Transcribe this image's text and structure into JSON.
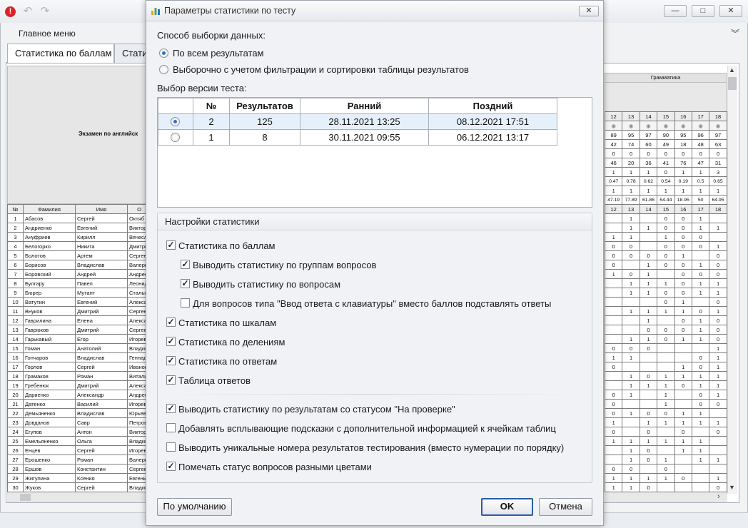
{
  "main_window": {
    "menu": "Главное меню",
    "tabs": [
      "Статистика по баллам",
      "Стати"
    ],
    "exam_title": "Экзамен по английск",
    "grammar_header": "Грамматика",
    "left_headers": [
      "№",
      "Фамилия",
      "Имя",
      "О"
    ],
    "students": [
      [
        "1",
        "Абасов",
        "Сергей",
        "Октяб"
      ],
      [
        "2",
        "Андриенко",
        "Евгений",
        "Виктор"
      ],
      [
        "3",
        "Ануфриев",
        "Кирилл",
        "Вячесл"
      ],
      [
        "4",
        "Белогорко",
        "Никита",
        "Дмитри"
      ],
      [
        "5",
        "Болотов",
        "Артем",
        "Сергее"
      ],
      [
        "6",
        "Борисов",
        "Владислав",
        "Валери"
      ],
      [
        "7",
        "Боровский",
        "Андрей",
        "Андрее"
      ],
      [
        "8",
        "Булгару",
        "Павел",
        "Леонид"
      ],
      [
        "9",
        "Бюрер",
        "Мутант",
        "Стальн"
      ],
      [
        "10",
        "Ватутин",
        "Евгений",
        "Алекса"
      ],
      [
        "11",
        "Внуков",
        "Дмитрий",
        "Сергее"
      ],
      [
        "12",
        "Гаврилина",
        "Елена",
        "Алекса"
      ],
      [
        "13",
        "Гаврюков",
        "Дмитрий",
        "Сергее"
      ],
      [
        "14",
        "Гарькавый",
        "Егор",
        "Игорев"
      ],
      [
        "15",
        "Гоман",
        "Анатолий",
        "Владим"
      ],
      [
        "16",
        "Гончаров",
        "Владислав",
        "Геннад"
      ],
      [
        "17",
        "Горлов",
        "Сергей",
        "Иванов"
      ],
      [
        "18",
        "Грамаков",
        "Роман",
        "Витали"
      ],
      [
        "19",
        "Гребенюк",
        "Дмитрий",
        "Алекса"
      ],
      [
        "20",
        "Дариенко",
        "Александр",
        "Андрее"
      ],
      [
        "21",
        "Датенко",
        "Василий",
        "Игорев"
      ],
      [
        "22",
        "Демьяненко",
        "Владислав",
        "Юрьеви"
      ],
      [
        "23",
        "Довданов",
        "Савр",
        "Петров"
      ],
      [
        "24",
        "Егупов",
        "Антон",
        "Виктор"
      ],
      [
        "25",
        "Емельяненко",
        "Ольга",
        "Владим"
      ],
      [
        "26",
        "Енцев",
        "Сергей",
        "Игорев"
      ],
      [
        "27",
        "Ерошенко",
        "Роман",
        "Валери"
      ],
      [
        "28",
        "Ершов",
        "Константин",
        "Сергее"
      ],
      [
        "29",
        "Жигулина",
        "Ксения",
        "Евгень"
      ],
      [
        "30",
        "Жуков",
        "Сергей",
        "Владим"
      ]
    ],
    "right_columns": [
      "12",
      "13",
      "14",
      "15",
      "16",
      "17",
      "18"
    ],
    "right_summary": [
      [
        "89",
        "95",
        "97",
        "90",
        "95",
        "96",
        "97"
      ],
      [
        "42",
        "74",
        "60",
        "49",
        "18",
        "48",
        "63"
      ],
      [
        "0",
        "0",
        "0",
        "0",
        "0",
        "0",
        "0"
      ],
      [
        "46",
        "20",
        "36",
        "41",
        "76",
        "47",
        "31"
      ],
      [
        "1",
        "1",
        "1",
        "0",
        "1",
        "1",
        "3"
      ],
      [
        "0.47",
        "0.78",
        "0.62",
        "0.54",
        "0.19",
        "0.5",
        "0.65"
      ],
      [
        "1",
        "1",
        "1",
        "1",
        "1",
        "1",
        "1"
      ],
      [
        "47.19",
        "77.89",
        "61.86",
        "54.44",
        "18.95",
        "50",
        "64.95"
      ]
    ],
    "right_rows": [
      [
        "",
        "1",
        "",
        "0",
        "0",
        "1",
        ""
      ],
      [
        "",
        "1",
        "1",
        "0",
        "0",
        "1",
        "1"
      ],
      [
        "1",
        "1",
        "",
        "1",
        "0",
        "0",
        ""
      ],
      [
        "0",
        "0",
        "",
        "0",
        "0",
        "0",
        "1"
      ],
      [
        "0",
        "0",
        "0",
        "0",
        "1",
        "",
        "0"
      ],
      [
        "0",
        "",
        "1",
        "0",
        "0",
        "1",
        "0"
      ],
      [
        "1",
        "0",
        "1",
        "",
        "0",
        "0",
        "0"
      ],
      [
        "",
        "1",
        "1",
        "1",
        "0",
        "1",
        "1"
      ],
      [
        "",
        "1",
        "1",
        "0",
        "0",
        "1",
        "1"
      ],
      [
        "",
        "",
        "",
        "0",
        "1",
        "",
        "0"
      ],
      [
        "",
        "1",
        "1",
        "1",
        "1",
        "0",
        "1"
      ],
      [
        "",
        "",
        "1",
        "",
        "0",
        "1",
        "0"
      ],
      [
        "",
        "",
        "0",
        "0",
        "0",
        "1",
        "0"
      ],
      [
        "",
        "1",
        "1",
        "0",
        "1",
        "1",
        "0"
      ],
      [
        "0",
        "0",
        "0",
        "",
        "",
        "",
        "1"
      ],
      [
        "1",
        "1",
        "",
        "",
        "",
        "0",
        "1"
      ],
      [
        "0",
        "",
        "",
        "",
        "1",
        "0",
        "1"
      ],
      [
        "",
        "1",
        "0",
        "1",
        "1",
        "1",
        "1"
      ],
      [
        "",
        "1",
        "1",
        "1",
        "0",
        "1",
        "1"
      ],
      [
        "0",
        "1",
        "",
        "1",
        "",
        "0",
        "1"
      ],
      [
        "0",
        "",
        "",
        "1",
        "",
        "0",
        "0"
      ],
      [
        "0",
        "1",
        "0",
        "0",
        "1",
        "1",
        ""
      ],
      [
        "1",
        "",
        "1",
        "1",
        "1",
        "1",
        "1"
      ],
      [
        "0",
        "",
        "0",
        "",
        "0",
        "",
        "0"
      ],
      [
        "1",
        "1",
        "1",
        "1",
        "1",
        "1",
        ""
      ],
      [
        "",
        "1",
        "0",
        "",
        "1",
        "1",
        ""
      ],
      [
        "",
        "1",
        "0",
        "1",
        "",
        "1",
        "1"
      ],
      [
        "0",
        "0",
        "",
        "0",
        "",
        "",
        ""
      ],
      [
        "1",
        "1",
        "1",
        "1",
        "0",
        "",
        "1"
      ],
      [
        "1",
        "1",
        "0",
        "",
        "",
        "",
        "0"
      ]
    ]
  },
  "dialog": {
    "title": "Параметры статистики по тесту",
    "sampling_label": "Способ выборки данных:",
    "sampling_options": [
      {
        "label": "По всем результатам",
        "selected": true
      },
      {
        "label": "Выборочно с учетом фильтрации и сортировки таблицы результатов",
        "selected": false
      }
    ],
    "version_label": "Выбор версии теста:",
    "version_columns": [
      "№",
      "Результатов",
      "Ранний",
      "Поздний"
    ],
    "versions": [
      {
        "selected": true,
        "no": "2",
        "results": "125",
        "early": "28.11.2021 13:25",
        "late": "08.12.2021 17:51"
      },
      {
        "selected": false,
        "no": "1",
        "results": "8",
        "early": "30.11.2021 09:55",
        "late": "06.12.2021 13:17"
      }
    ],
    "settings_title": "Настройки статистики",
    "options": [
      {
        "label": "Статистика по баллам",
        "checked": true
      },
      {
        "label": "Выводить статистику по группам вопросов",
        "checked": true
      },
      {
        "label": "Выводить статистику по вопросам",
        "checked": true
      },
      {
        "label": "Для вопросов типа \"Ввод ответа с клавиатуры\" вместо баллов подставлять ответы",
        "checked": false
      },
      {
        "label": "Статистика по шкалам",
        "checked": true
      },
      {
        "label": "Статистика по делениям",
        "checked": true
      },
      {
        "label": "Статистика по ответам",
        "checked": true
      },
      {
        "label": "Таблица ответов",
        "checked": true
      },
      {
        "label": "Выводить статистику по результатам со статусом \"На проверке\"",
        "checked": true
      },
      {
        "label": "Добавлять всплывающие подсказки с дополнительной информацией к ячейкам таблиц",
        "checked": false
      },
      {
        "label": "Выводить уникальные номера результатов тестирования (вместо нумерации по порядку)",
        "checked": false
      },
      {
        "label": "Помечать статус вопросов разными цветами",
        "checked": true
      }
    ],
    "buttons": {
      "default": "По умолчанию",
      "ok": "OK",
      "cancel": "Отмена"
    }
  },
  "colors": {
    "accent": "#2d6fd0",
    "selected_row": "#e5f0fb",
    "ok_border": "#2a5ca8"
  }
}
